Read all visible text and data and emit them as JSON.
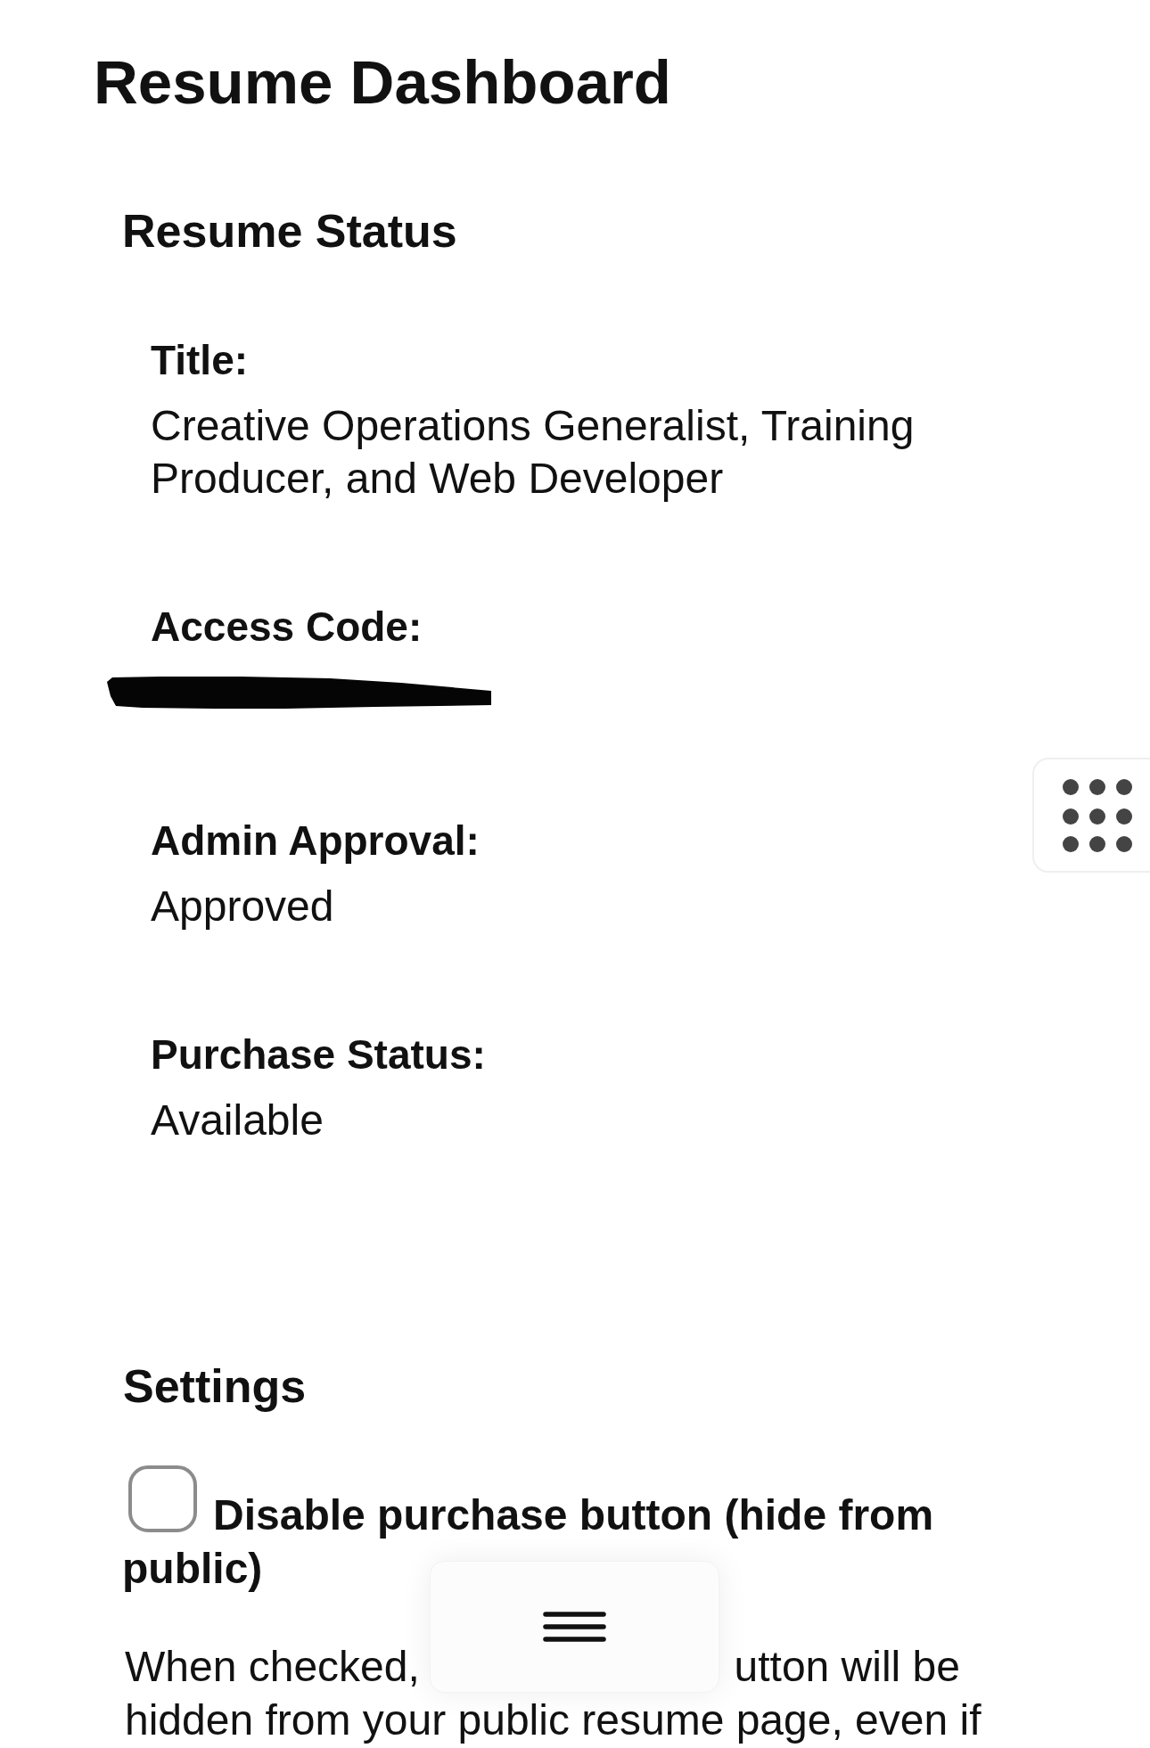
{
  "page": {
    "title": "Resume Dashboard"
  },
  "resume_status": {
    "heading": "Resume Status",
    "fields": [
      {
        "kind": "text",
        "label": "Title:",
        "value": "Creative Operations Generalist, Training Producer, and Web Developer"
      },
      {
        "kind": "redacted",
        "label": "Access Code:"
      },
      {
        "kind": "text",
        "label": "Admin Approval:",
        "value": "Approved"
      },
      {
        "kind": "text",
        "label": "Purchase Status:",
        "value": "Available"
      }
    ]
  },
  "settings": {
    "heading": "Settings",
    "options": [
      {
        "label_lines": [
          "Disable purchase button (hide from",
          "public)"
        ],
        "checked": false,
        "description_line_1": [
          "When checked,",
          "utton will be"
        ],
        "description_line_2": "hidden from your public resume page, even if"
      }
    ]
  }
}
